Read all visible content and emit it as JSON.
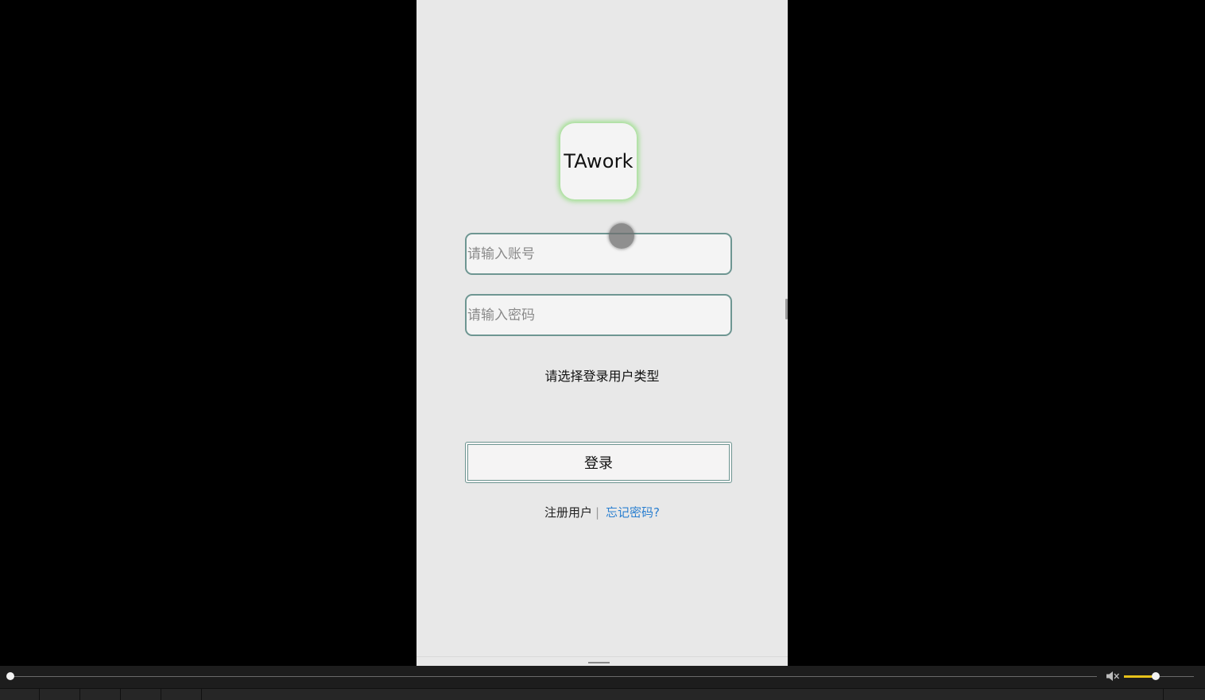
{
  "app": {
    "logo_text": "TAwork"
  },
  "login_form": {
    "account_placeholder": "请输入账号",
    "password_placeholder": "请输入密码",
    "user_type_prompt": "请选择登录用户类型",
    "login_label": "登录",
    "register_label": "注册用户",
    "divider": "|",
    "forgot_label": "忘记密码?"
  },
  "player": {
    "progress": 0.0,
    "volume": 0.45
  },
  "colors": {
    "phone_background": "#e8e8e8",
    "input_border": "#6e9692",
    "link_blue": "#2a7fd0",
    "volume_accent": "#e7c21a",
    "logo_glow": "#8cdc78"
  }
}
